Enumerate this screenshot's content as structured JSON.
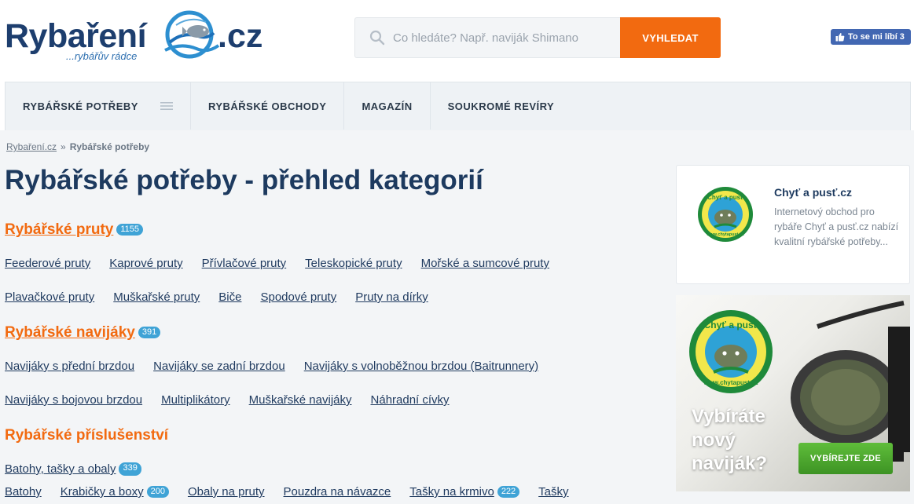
{
  "header": {
    "logo": {
      "name_left": "Rybaření",
      "name_right": ".cz",
      "tagline": "...rybářův rádce"
    },
    "search": {
      "placeholder": "Co hledáte? Např. naviják Shimano",
      "button_label": "VYHLEDAT"
    },
    "fb_like": {
      "label": "To se mi líbí 3"
    }
  },
  "nav": {
    "items": [
      {
        "label": "RYBÁŘSKÉ POTŘEBY",
        "icon": "hamburger-icon"
      },
      {
        "label": "RYBÁŘSKÉ OBCHODY"
      },
      {
        "label": "MAGAZÍN"
      },
      {
        "label": "SOUKROMÉ REVÍRY"
      }
    ]
  },
  "breadcrumb": {
    "home": "Rybaření.cz",
    "separator": "»",
    "current": "Rybářské potřeby"
  },
  "page_title": "Rybářské potřeby - přehled kategorií",
  "categories": [
    {
      "title": "Rybářské pruty",
      "count": "1155",
      "rows": [
        [
          "Feederové pruty",
          "Kaprové pruty",
          "Přívlačové pruty",
          "Teleskopické pruty",
          "Mořské a sumcové pruty"
        ],
        [
          "Plavačkové pruty",
          "Muškařské pruty",
          "Biče",
          "Spodové pruty",
          "Pruty na dírky"
        ]
      ]
    },
    {
      "title": "Rybářské navijáky",
      "count": "391",
      "rows": [
        [
          "Navijáky s přední brzdou",
          "Navijáky se zadní brzdou",
          "Navijáky s volnoběžnou brzdou (Baitrunnery)"
        ],
        [
          "Navijáky s bojovou brzdou",
          "Multiplikátory",
          "Muškařské navijáky",
          "Náhradní cívky"
        ]
      ]
    },
    {
      "title": "Rybářské příslušenství",
      "subheading": {
        "label": "Batohy, tašky a obaly",
        "count": "339"
      },
      "row": [
        {
          "label": "Batohy"
        },
        {
          "label": "Krabičky a boxy",
          "count": "200"
        },
        {
          "label": "Obaly na pruty"
        },
        {
          "label": "Pouzdra na návazce"
        },
        {
          "label": "Tašky na krmivo",
          "count": "222"
        },
        {
          "label": "Tašky"
        }
      ]
    }
  ],
  "sidebar": {
    "shop_card": {
      "title": "Chyť a pusť.cz",
      "description": "Internetový obchod pro rybáře Chyť a pusť.cz nabízí kvalitní rybářské potřeby...",
      "logo_text_top": "Chyť a pusť",
      "logo_text_bottom": "www.chytapust.cz"
    },
    "banner": {
      "headline": "Vybíráte\nnový\nnaviják?",
      "cta_label": "VYBÍREJTE ZDE"
    }
  },
  "colors": {
    "brand_navy": "#1d3e6e",
    "accent_orange": "#f26a10",
    "count_badge": "#3fa3d6",
    "fb_blue": "#4267b2",
    "cta_green": "#4ea82e"
  }
}
